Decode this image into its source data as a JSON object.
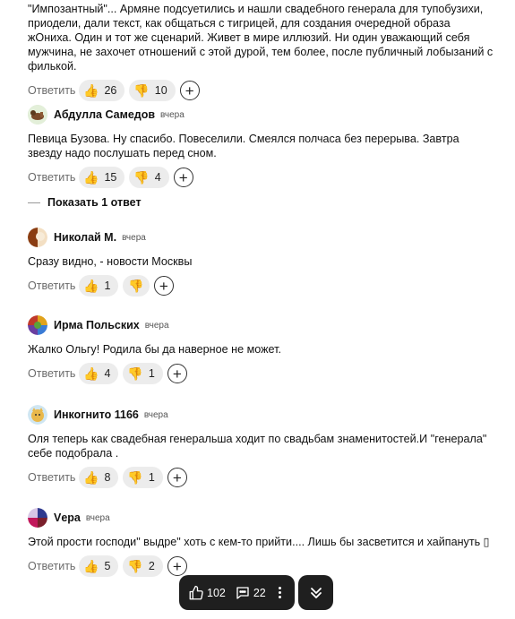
{
  "reply_label": "Ответить",
  "show_replies": "Показать 1 ответ",
  "comments": [
    {
      "author": "",
      "time": "",
      "text": "\"Импозантный\"... Армяне подсуетились и нашли свадебного генерала для тупобузихи, приодели, дали текст, как общаться с тигрицей, для создания очередной образа жОниха. Один и тот же сценарий. Живет в мире иллюзий. Ни один уважающий себя мужчина, не захочет отношений с этой дурой, тем более, после публичный лобызаний с филькой.",
      "likes": "26",
      "dislikes": "10"
    },
    {
      "author": "Абдулла Самедов",
      "time": "вчера",
      "text": "Певица Бузова. Ну спасибо. Повеселили. Смеялся полчаса без перерыва. Завтра звезду надо послушать перед сном.",
      "likes": "15",
      "dislikes": "4"
    },
    {
      "author": "Николай М.",
      "time": "вчера",
      "text": "Сразу видно, - новости Москвы",
      "likes": "1",
      "dislikes": ""
    },
    {
      "author": "Ирма Польских",
      "time": "вчера",
      "text": "Жалко Ольгу! Родила бы да наверное не может.",
      "likes": "4",
      "dislikes": "1"
    },
    {
      "author": "Инкогнито 1166",
      "time": "вчера",
      "text": "Оля теперь как свадебная генеральша ходит по свадьбам знаменитостей.И \"генерала\" себе подобрала .",
      "likes": "8",
      "dislikes": "1"
    },
    {
      "author": "Vера",
      "time": "вчера",
      "text": "Этой прости господи\" выдре\" хоть с кем-то прийти.... Лишь бы засветится и хайпануть ▯",
      "likes": "5",
      "dislikes": "2"
    }
  ],
  "bottom_bar": {
    "likes_count": "102",
    "comments_count": "22"
  },
  "icons": {
    "like": "thumbs-up-icon",
    "dislike": "thumbs-down-icon",
    "add_reaction": "plus-icon",
    "scroll_down": "double-chevron-down-icon"
  },
  "colors": {
    "pill_bg": "#ececec",
    "bar_bg": "#1f1f1f",
    "reply_text": "#6b6b6b"
  }
}
